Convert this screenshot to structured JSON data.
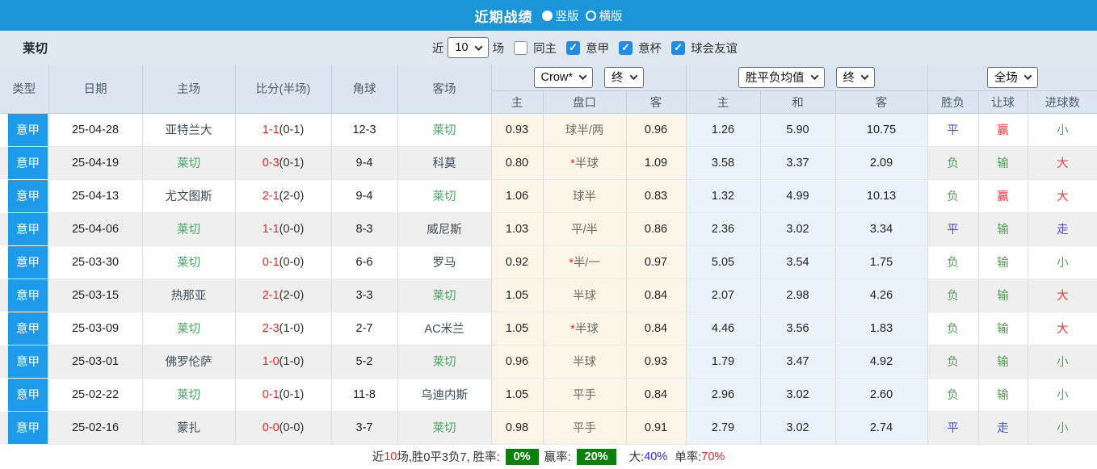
{
  "titlebar": {
    "title": "近期战绩",
    "portrait_label": "竖版",
    "landscape_label": "横版"
  },
  "filterbar": {
    "team": "莱切",
    "recent_label": "近",
    "count_value": "10",
    "games_label": "场",
    "check_glyph": "✓",
    "checkboxes": [
      {
        "label": "同主",
        "checked": false
      },
      {
        "label": "意甲",
        "checked": true
      },
      {
        "label": "意杯",
        "checked": true
      },
      {
        "label": "球会友谊",
        "checked": true
      }
    ]
  },
  "table": {
    "headers": {
      "type": "类型",
      "date": "日期",
      "home": "主场",
      "score": "比分(半场)",
      "corner": "角球",
      "away": "客场",
      "odds_company_select": "Crow*",
      "odds_period_select": "终",
      "avg_type_select": "胜平负均值",
      "avg_period_select": "终",
      "scope_select": "全场",
      "sub": [
        "主",
        "盘口",
        "客",
        "主",
        "和",
        "客",
        "胜负",
        "让球",
        "进球数"
      ]
    },
    "rows": [
      {
        "league": "意甲",
        "date": "25-04-28",
        "home": "亚特兰大",
        "home_hl": false,
        "score_ft": "1-1",
        "score_ht": "(0-1)",
        "corners": "12-3",
        "away": "莱切",
        "away_hl": true,
        "odds_home": "0.93",
        "handicap": {
          "star": "",
          "text": "球半/两"
        },
        "odds_away": "0.96",
        "avg_home": "1.26",
        "avg_draw": "5.90",
        "avg_away": "10.75",
        "outcome": {
          "text": "平",
          "color": "blue"
        },
        "handicap_result": {
          "text": "赢",
          "color": "red"
        },
        "goals_result": {
          "text": "小",
          "color": "green"
        }
      },
      {
        "league": "意甲",
        "date": "25-04-19",
        "home": "莱切",
        "home_hl": true,
        "score_ft": "0-3",
        "score_ht": "(0-1)",
        "corners": "9-4",
        "away": "科莫",
        "away_hl": false,
        "odds_home": "0.80",
        "handicap": {
          "star": "*",
          "text": "半球"
        },
        "odds_away": "1.09",
        "avg_home": "3.58",
        "avg_draw": "3.37",
        "avg_away": "2.09",
        "outcome": {
          "text": "负",
          "color": "green"
        },
        "handicap_result": {
          "text": "输",
          "color": "green"
        },
        "goals_result": {
          "text": "大",
          "color": "red"
        }
      },
      {
        "league": "意甲",
        "date": "25-04-13",
        "home": "尤文图斯",
        "home_hl": false,
        "score_ft": "2-1",
        "score_ht": "(2-0)",
        "corners": "9-4",
        "away": "莱切",
        "away_hl": true,
        "odds_home": "1.06",
        "handicap": {
          "star": "",
          "text": "球半"
        },
        "odds_away": "0.83",
        "avg_home": "1.32",
        "avg_draw": "4.99",
        "avg_away": "10.13",
        "outcome": {
          "text": "负",
          "color": "green"
        },
        "handicap_result": {
          "text": "赢",
          "color": "red"
        },
        "goals_result": {
          "text": "大",
          "color": "red"
        }
      },
      {
        "league": "意甲",
        "date": "25-04-06",
        "home": "莱切",
        "home_hl": true,
        "score_ft": "1-1",
        "score_ht": "(0-0)",
        "corners": "8-3",
        "away": "威尼斯",
        "away_hl": false,
        "odds_home": "1.03",
        "handicap": {
          "star": "",
          "text": "平/半"
        },
        "odds_away": "0.86",
        "avg_home": "2.36",
        "avg_draw": "3.02",
        "avg_away": "3.34",
        "outcome": {
          "text": "平",
          "color": "blue"
        },
        "handicap_result": {
          "text": "输",
          "color": "green"
        },
        "goals_result": {
          "text": "走",
          "color": "blue"
        }
      },
      {
        "league": "意甲",
        "date": "25-03-30",
        "home": "莱切",
        "home_hl": true,
        "score_ft": "0-1",
        "score_ht": "(0-0)",
        "corners": "6-6",
        "away": "罗马",
        "away_hl": false,
        "odds_home": "0.92",
        "handicap": {
          "star": "*",
          "text": "半/一"
        },
        "odds_away": "0.97",
        "avg_home": "5.05",
        "avg_draw": "3.54",
        "avg_away": "1.75",
        "outcome": {
          "text": "负",
          "color": "green"
        },
        "handicap_result": {
          "text": "输",
          "color": "green"
        },
        "goals_result": {
          "text": "小",
          "color": "green"
        }
      },
      {
        "league": "意甲",
        "date": "25-03-15",
        "home": "热那亚",
        "home_hl": false,
        "score_ft": "2-1",
        "score_ht": "(2-0)",
        "corners": "3-3",
        "away": "莱切",
        "away_hl": true,
        "odds_home": "1.05",
        "handicap": {
          "star": "",
          "text": "半球"
        },
        "odds_away": "0.84",
        "avg_home": "2.07",
        "avg_draw": "2.98",
        "avg_away": "4.26",
        "outcome": {
          "text": "负",
          "color": "green"
        },
        "handicap_result": {
          "text": "输",
          "color": "green"
        },
        "goals_result": {
          "text": "大",
          "color": "red"
        }
      },
      {
        "league": "意甲",
        "date": "25-03-09",
        "home": "莱切",
        "home_hl": true,
        "score_ft": "2-3",
        "score_ht": "(1-0)",
        "corners": "2-7",
        "away": "AC米兰",
        "away_hl": false,
        "odds_home": "1.05",
        "handicap": {
          "star": "*",
          "text": "半球"
        },
        "odds_away": "0.84",
        "avg_home": "4.46",
        "avg_draw": "3.56",
        "avg_away": "1.83",
        "outcome": {
          "text": "负",
          "color": "green"
        },
        "handicap_result": {
          "text": "输",
          "color": "green"
        },
        "goals_result": {
          "text": "大",
          "color": "red"
        }
      },
      {
        "league": "意甲",
        "date": "25-03-01",
        "home": "佛罗伦萨",
        "home_hl": false,
        "score_ft": "1-0",
        "score_ht": "(1-0)",
        "corners": "5-2",
        "away": "莱切",
        "away_hl": true,
        "odds_home": "0.96",
        "handicap": {
          "star": "",
          "text": "半球"
        },
        "odds_away": "0.93",
        "avg_home": "1.79",
        "avg_draw": "3.47",
        "avg_away": "4.92",
        "outcome": {
          "text": "负",
          "color": "green"
        },
        "handicap_result": {
          "text": "输",
          "color": "green"
        },
        "goals_result": {
          "text": "小",
          "color": "green"
        }
      },
      {
        "league": "意甲",
        "date": "25-02-22",
        "home": "莱切",
        "home_hl": true,
        "score_ft": "0-1",
        "score_ht": "(0-1)",
        "corners": "11-8",
        "away": "乌迪内斯",
        "away_hl": false,
        "odds_home": "1.05",
        "handicap": {
          "star": "",
          "text": "平手"
        },
        "odds_away": "0.84",
        "avg_home": "2.96",
        "avg_draw": "3.02",
        "avg_away": "2.60",
        "outcome": {
          "text": "负",
          "color": "green"
        },
        "handicap_result": {
          "text": "输",
          "color": "green"
        },
        "goals_result": {
          "text": "小",
          "color": "green"
        }
      },
      {
        "league": "意甲",
        "date": "25-02-16",
        "home": "蒙扎",
        "home_hl": false,
        "score_ft": "0-0",
        "score_ht": "(0-0)",
        "corners": "3-7",
        "away": "莱切",
        "away_hl": true,
        "odds_home": "0.98",
        "handicap": {
          "star": "",
          "text": "平手"
        },
        "odds_away": "0.91",
        "avg_home": "2.79",
        "avg_draw": "3.02",
        "avg_away": "2.74",
        "outcome": {
          "text": "平",
          "color": "blue"
        },
        "handicap_result": {
          "text": "走",
          "color": "blue"
        },
        "goals_result": {
          "text": "小",
          "color": "green"
        }
      }
    ]
  },
  "summary": {
    "prefix": "近",
    "recent_count": "10",
    "record": "场,胜0平3负7, 胜率:",
    "win_rate_badge": "0%",
    "win_pct_label": "赢率:",
    "win_pct_badge": "20%",
    "big_label": "大:",
    "big_value": "40%",
    "single_label": "单率:",
    "single_value": "70%"
  },
  "colors": {
    "topbar_blue": "#1b95d8",
    "league_badge_blue": "#1e9aeb",
    "header_bg": "#dce6f1",
    "handicap_col_bg": "#fbf5e8",
    "avg_col_bg": "#e9f3f9",
    "win_red": "#f53b3b",
    "draw_blue": "#4a4af0",
    "lose_green": "#52a052",
    "team_highlight_green": "#4aa266",
    "badge_green": "#0e800e"
  }
}
